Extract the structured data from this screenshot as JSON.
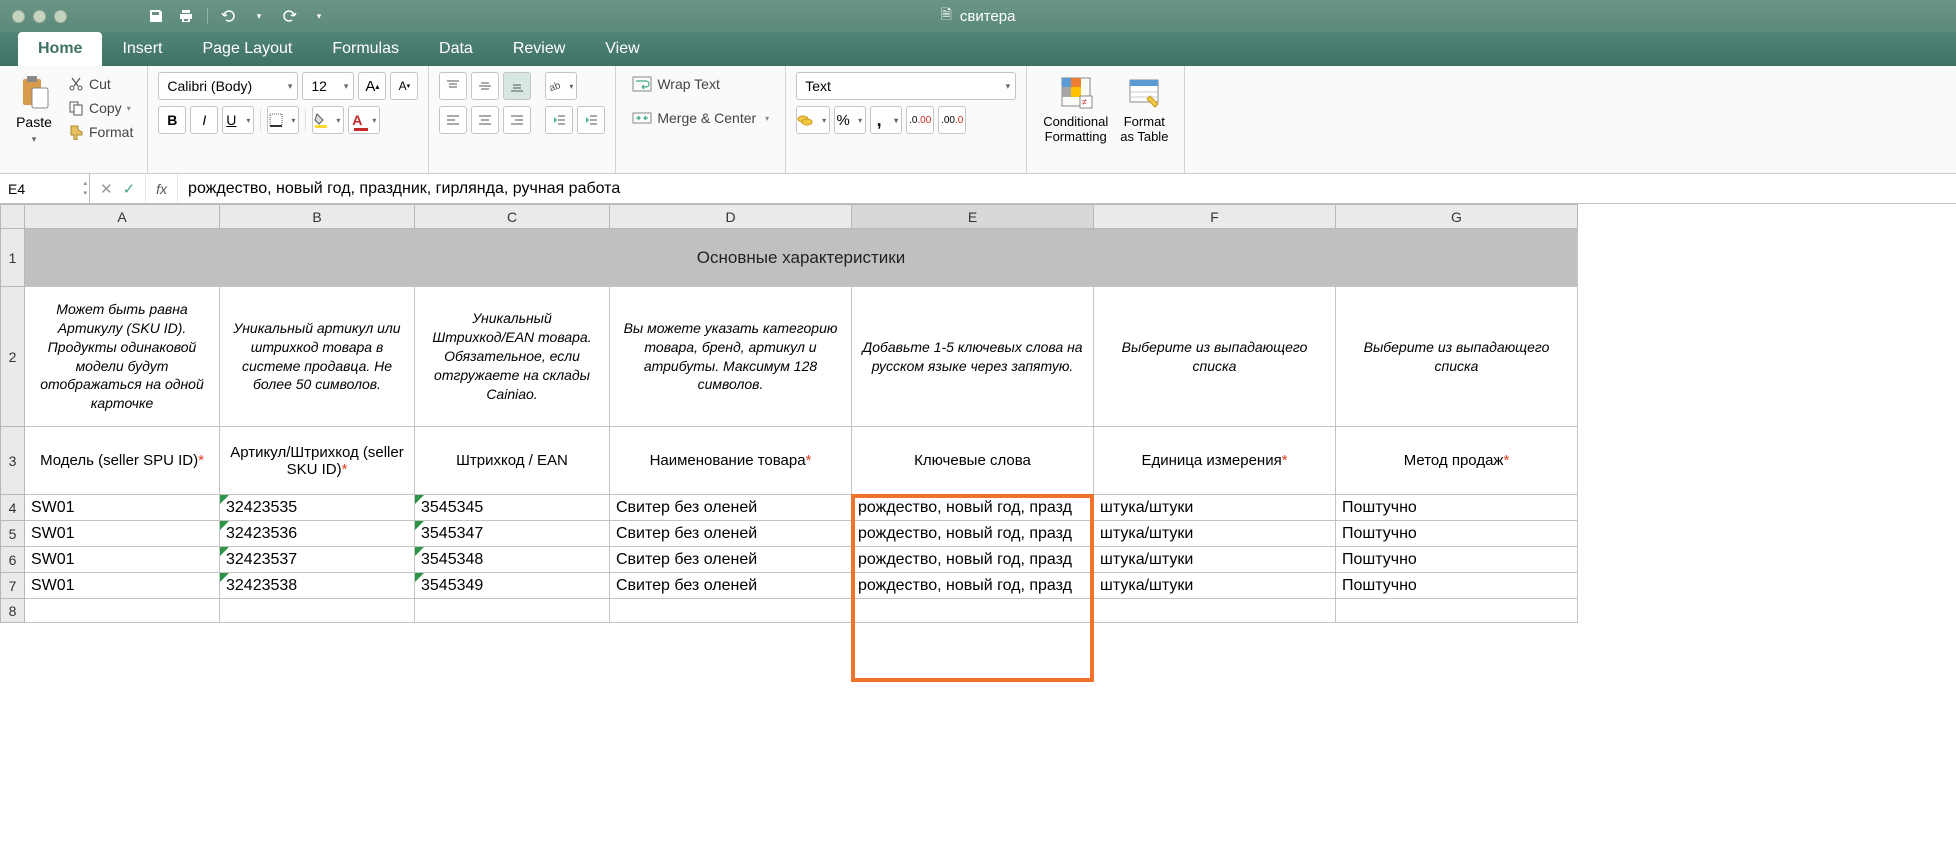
{
  "document": {
    "title": "свитера"
  },
  "tabs": [
    "Home",
    "Insert",
    "Page Layout",
    "Formulas",
    "Data",
    "Review",
    "View"
  ],
  "clipboard": {
    "cut": "Cut",
    "copy": "Copy",
    "format": "Format",
    "paste": "Paste"
  },
  "font": {
    "family": "Calibri (Body)",
    "size": "12"
  },
  "styles": {
    "bold": "B",
    "italic": "I",
    "underline": "U"
  },
  "wrapText": "Wrap Text",
  "mergeCenter": "Merge & Center",
  "numberFormat": "Text",
  "groupLabels": {
    "conditional": "Conditional\nFormatting",
    "formatTable": "Format\nas Table"
  },
  "nameBox": "E4",
  "formula": "рождество, новый год, праздник, гирлянда, ручная работа",
  "columns": [
    "A",
    "B",
    "C",
    "D",
    "E",
    "F",
    "G"
  ],
  "mergedTitle": "Основные характеристики",
  "descriptions": [
    "Может быть равна Артикулу (SKU ID). Продукты одинаковой модели будут отображаться на одной карточке",
    "Уникальный артикул или штрихкод товара в системе продавца. Не более 50 символов.",
    "Уникальный Штрихкод/EAN товара. Обязательное, если отгружаете на склады Cainiao.",
    "Вы можете указать категорию товара, бренд, артикул и атрибуты. Максимум 128 символов.",
    "Добавьте 1-5 ключевых слова на русском языке через запятую.",
    "Выберите из выпадающего списка",
    "Выберите из выпадающего списка"
  ],
  "headers": [
    {
      "t": "Модель (seller SPU ID)",
      "r": true
    },
    {
      "t": "Артикул/Штрихкод (seller SKU ID)",
      "r": true
    },
    {
      "t": "Штрихкод  / EAN",
      "r": false
    },
    {
      "t": "Наименование товара",
      "r": true
    },
    {
      "t": "Ключевые слова",
      "r": false
    },
    {
      "t": "Единица измерения",
      "r": true
    },
    {
      "t": "Метод продаж",
      "r": true
    }
  ],
  "rows": [
    {
      "n": "4",
      "c": [
        "SW01",
        "32423535",
        "3545345",
        "Свитер без оленей",
        "рождество, новый год, празд",
        "штука/штуки",
        "Поштучно"
      ]
    },
    {
      "n": "5",
      "c": [
        "SW01",
        "32423536",
        "3545347",
        "Свитер без оленей",
        "рождество, новый год, празд",
        "штука/штуки",
        "Поштучно"
      ]
    },
    {
      "n": "6",
      "c": [
        "SW01",
        "32423537",
        "3545348",
        "Свитер без оленей",
        "рождество, новый год, празд",
        "штука/штуки",
        "Поштучно"
      ]
    },
    {
      "n": "7",
      "c": [
        "SW01",
        "32423538",
        "3545349",
        "Свитер без оленей",
        "рождество, новый год, празд",
        "штука/штуки",
        "Поштучно"
      ]
    }
  ]
}
